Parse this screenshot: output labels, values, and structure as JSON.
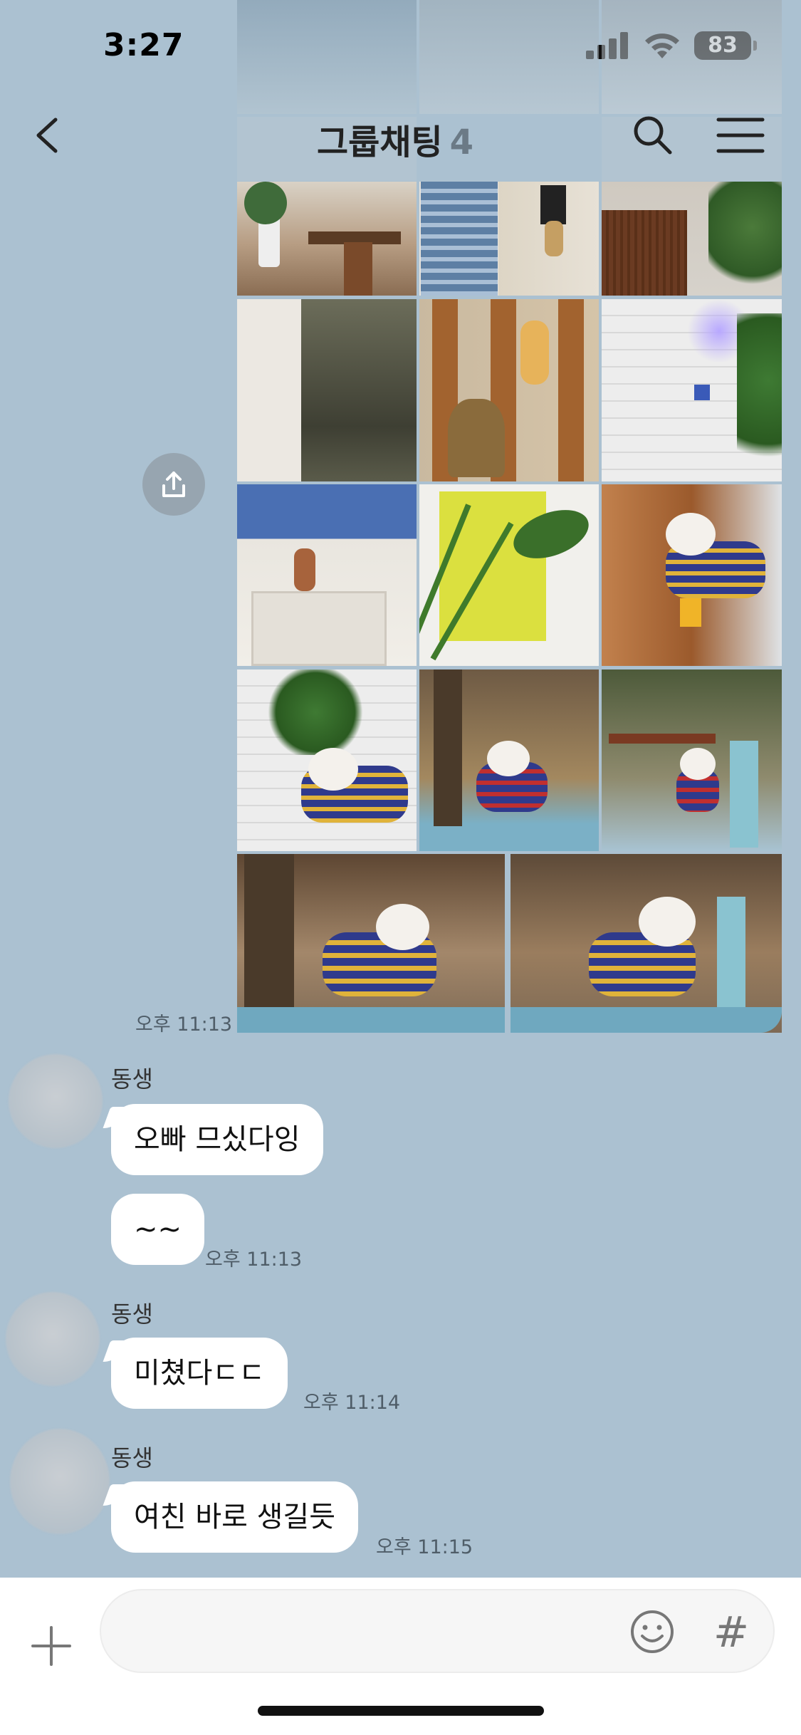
{
  "status_bar": {
    "time": "3:27",
    "battery": "83",
    "icons": [
      "cellular-signal-icon",
      "wifi-icon",
      "battery-icon"
    ]
  },
  "header": {
    "title": "그룹채팅",
    "member_count": "4",
    "icons": [
      "back-chevron-icon",
      "search-icon",
      "hamburger-menu-icon"
    ]
  },
  "photo_message": {
    "time": "오후 11:13",
    "share_icon": "share-upload-icon",
    "photos": [
      "cafe-interior-chairs",
      "window-city-view",
      "wall-pendant-lamp",
      "cafe-counter-plants",
      "tree-rest-poster",
      "pendant-lamp-wood",
      "white-brick-wall-art",
      "shelf-vase-speaker",
      "plant-yellow-wall",
      "dog-striped-shirt-bench",
      "dog-cafe-plants",
      "dog-forest-table",
      "dog-park-bench",
      "dog-forest-standing",
      "dog-blue-table"
    ]
  },
  "messages": [
    {
      "sender": "동생",
      "bubbles": [
        {
          "text": "오빠 므싰다잉"
        },
        {
          "text": "~~",
          "time": "오후 11:13"
        }
      ]
    },
    {
      "sender": "동생",
      "bubbles": [
        {
          "text": "미쳤다ㄷㄷ",
          "time": "오후 11:14"
        }
      ]
    },
    {
      "sender": "동생",
      "bubbles": [
        {
          "text": "여친 바로 생길듯",
          "time": "오후 11:15"
        }
      ]
    }
  ],
  "input_bar": {
    "placeholder": "",
    "value": "",
    "icons": [
      "plus-icon",
      "emoji-icon",
      "hashtag-icon"
    ],
    "hash_label": "#"
  },
  "colors": {
    "chat_background": "#abc1d1",
    "bubble": "#ffffff",
    "input_bar": "#ffffff"
  }
}
